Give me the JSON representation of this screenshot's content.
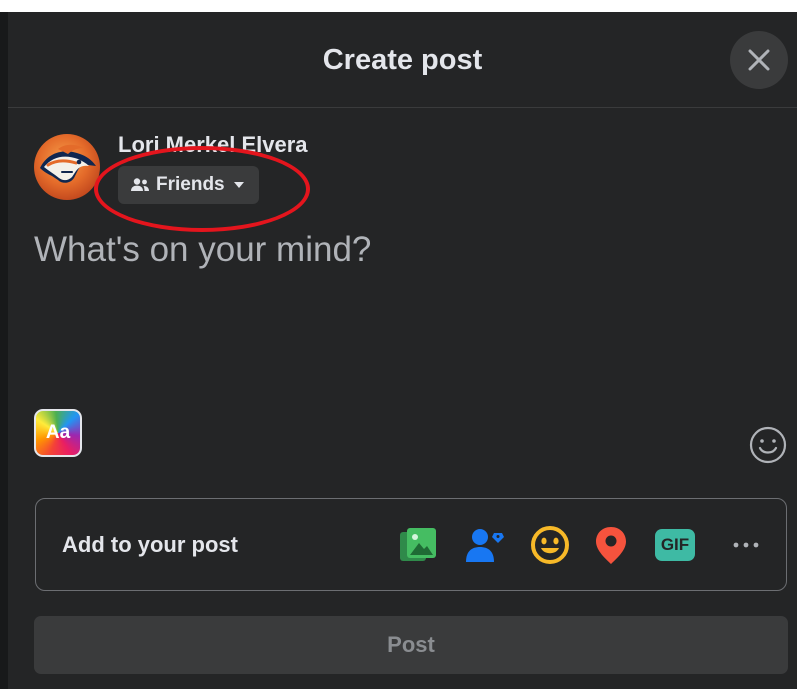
{
  "dialog": {
    "title": "Create post",
    "close_icon": "close-icon"
  },
  "author": {
    "name": "Lori Merkel Elvera",
    "avatar_icon": "avatar-broncos-logo",
    "audience": {
      "label": "Friends",
      "icon": "friends-icon",
      "caret_icon": "caret-down-icon"
    }
  },
  "composer": {
    "placeholder": "What's on your mind?",
    "text_style_label": "Aa",
    "emoji_icon": "smiley-icon"
  },
  "add_to_post": {
    "label": "Add to your post",
    "tools": [
      {
        "name": "photo-video",
        "icon": "photo-icon",
        "color": "#45bd62"
      },
      {
        "name": "tag-people",
        "icon": "tag-people-icon",
        "color": "#1877f2"
      },
      {
        "name": "feeling-activity",
        "icon": "feeling-icon",
        "color": "#f7b928"
      },
      {
        "name": "check-in",
        "icon": "location-pin-icon",
        "color": "#f5533d"
      },
      {
        "name": "gif",
        "icon": "gif-icon",
        "label": "GIF",
        "color": "#3ebaa4"
      },
      {
        "name": "more",
        "icon": "more-icon",
        "color": "#b0b3b8"
      }
    ]
  },
  "post_button": {
    "label": "Post"
  },
  "annotation": {
    "color": "#e4151d",
    "target": "audience-selector"
  }
}
